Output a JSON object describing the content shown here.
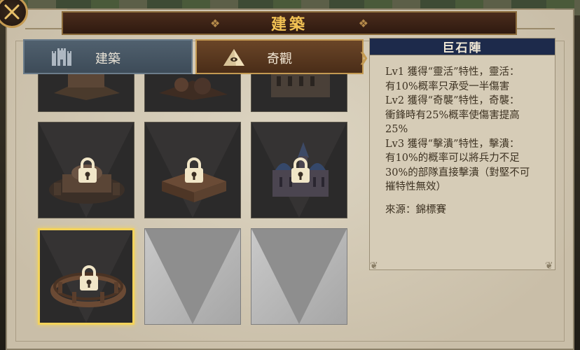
{
  "window": {
    "title": "建築",
    "close_icon": "close-icon"
  },
  "tabs": [
    {
      "label": "建築",
      "icon": "castle-icon",
      "active": false
    },
    {
      "label": "奇觀",
      "icon": "pyramid-icon",
      "active": true
    }
  ],
  "grid": {
    "cells": [
      {
        "name": "wonder-1",
        "locked": false,
        "partial": true
      },
      {
        "name": "wonder-2",
        "locked": false,
        "partial": true
      },
      {
        "name": "wonder-3",
        "locked": false,
        "partial": true
      },
      {
        "name": "wonder-hagia",
        "locked": true
      },
      {
        "name": "wonder-library",
        "locked": true
      },
      {
        "name": "wonder-cathedral",
        "locked": true
      },
      {
        "name": "wonder-stonehenge",
        "locked": true,
        "selected": true
      },
      {
        "name": "empty-slot-1",
        "empty": true
      },
      {
        "name": "empty-slot-2",
        "empty": true
      }
    ]
  },
  "info": {
    "title": "巨石陣",
    "lines": [
      "Lv1 獲得“靈活”特性，靈活：",
      "有10%概率只承受一半傷害",
      "Lv2 獲得“奇襲”特性，奇襲：",
      "衝鋒時有25%概率使傷害提高",
      "25%",
      "Lv3 獲得“擊潰”特性，擊潰：",
      "有10%的概率可以將兵力不足",
      "30%的部隊直接擊潰（對堅不可",
      "摧特性無效）"
    ],
    "source": "來源：錦標賽"
  },
  "colors": {
    "accent_gold": "#f2c254",
    "selected_border": "#f3d35b",
    "info_header": "#1d2a4b"
  }
}
